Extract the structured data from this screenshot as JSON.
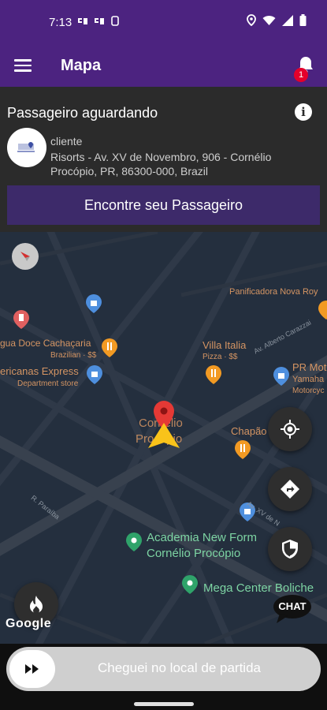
{
  "status_bar": {
    "time": "7:13",
    "left_icons": [
      "sim-icon",
      "sim-icon",
      "sim-icon",
      "notification-icon"
    ],
    "right_icons": [
      "location-icon",
      "wifi-icon",
      "signal-icon",
      "battery-icon"
    ]
  },
  "app_bar": {
    "title": "Mapa",
    "notification_count": "1"
  },
  "panel": {
    "title": "Passageiro aguardando",
    "client_label": "cliente",
    "address": "Risorts - Av. XV de Novembro, 906 - Cornélio Procópio, PR, 86300-000, Brazil",
    "find_button": "Encontre seu Passageiro"
  },
  "map": {
    "labels": {
      "panificadora": "Panificadora Nova Roy",
      "agua_doce": "gua Doce Cachaçaria",
      "brazilian": "Brazilian · $$",
      "villa_italia": "Villa Italia",
      "pizza": "Pizza · $$",
      "americanas": "ericanas Express",
      "department": "Department store",
      "pr_moto": "PR Mot",
      "yamaha": "Yamaha",
      "motorcycle": "Motorcyc",
      "chapadao": "Chapão",
      "city_line1": "Cornélio",
      "city_line2": "Procópio",
      "academia_line1": "Academia New Form",
      "academia_line2": "Cornélio Procópio",
      "mega_center": "Mega Center Boliche",
      "road_parana": "R. Paraíba",
      "road_alberto": "Av. Alberto Carazzai",
      "road_nova": "Av. XV de N"
    },
    "google": "Google",
    "chat": "CHAT"
  },
  "bottom": {
    "slide_label": "Cheguei no local de partida"
  },
  "colors": {
    "primary": "#4c2380",
    "map_bg": "#242f3e",
    "marker_red": "#e53935",
    "arrow_yellow": "#f9c31a"
  }
}
